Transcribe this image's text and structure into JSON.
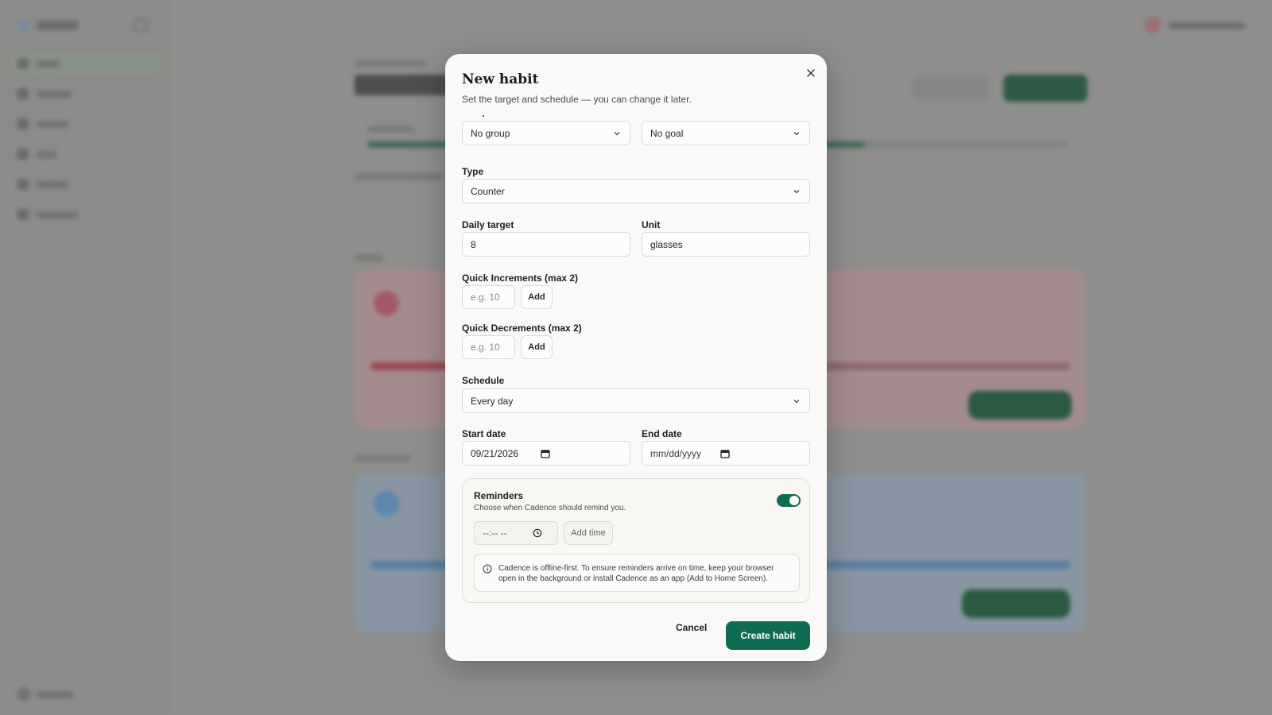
{
  "modal": {
    "title": "New habit",
    "subtitle": "Set the target and schedule — you can change it later.",
    "close_icon": "close-icon"
  },
  "group_select": {
    "value": "No group",
    "icon": "chevron-down-icon"
  },
  "goal_select": {
    "value": "No goal",
    "icon": "chevron-down-icon"
  },
  "type": {
    "label": "Type",
    "value": "Counter"
  },
  "daily_target": {
    "label": "Daily target",
    "value": "8"
  },
  "unit": {
    "label": "Unit",
    "value": "glasses"
  },
  "quick_increments": {
    "label": "Quick Increments (max 2)",
    "placeholder": "e.g. 10",
    "add_label": "Add"
  },
  "quick_decrements": {
    "label": "Quick Decrements (max 2)",
    "placeholder": "e.g. 10",
    "add_label": "Add"
  },
  "schedule": {
    "label": "Schedule",
    "value": "Every day"
  },
  "start_date": {
    "label": "Start date",
    "value": "09/21/2026",
    "icon": "calendar-icon"
  },
  "end_date": {
    "label": "End date",
    "value": "mm/dd/yyyy",
    "icon": "calendar-icon"
  },
  "reminders": {
    "title": "Reminders",
    "subtitle": "Choose when Cadence should remind you.",
    "enabled": true,
    "time_value": "--:-- --",
    "time_icon": "clock-icon",
    "add_time_label": "Add time",
    "info_icon": "info-icon",
    "info_text": "Cadence is offline-first. To ensure reminders arrive on time, keep your browser open in the background or install Cadence as an app (Add to Home Screen)."
  },
  "actions": {
    "cancel_label": "Cancel",
    "create_label": "Create habit"
  },
  "colors": {
    "accent": "#0f6b52",
    "backdrop": "#8e8e8c",
    "modal_bg": "#faf9f7"
  }
}
